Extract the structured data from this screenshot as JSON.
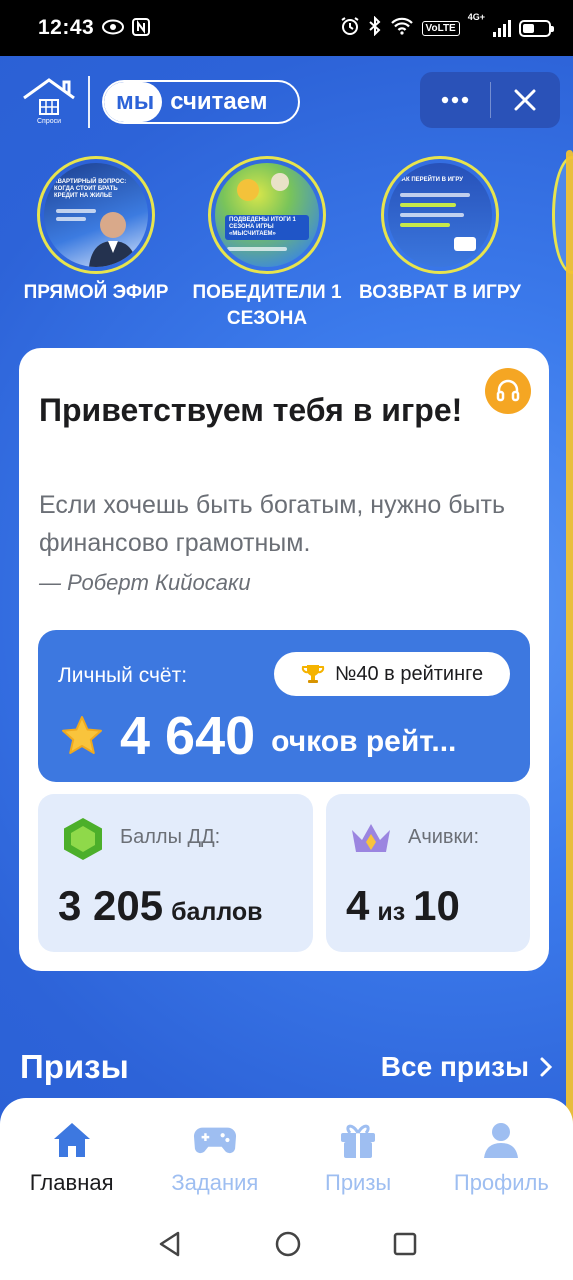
{
  "status_bar": {
    "time": "12:43",
    "network": "4G+",
    "volte": "VoLTE"
  },
  "header": {
    "logo_caption": "Спроси",
    "brand_part1": "мы",
    "brand_part2": "считаем",
    "more_icon": "more-dots-icon",
    "close_icon": "close-icon"
  },
  "stories": [
    {
      "label": "ПРЯМОЙ ЭФИР",
      "preview_text": "КВАРТИРНЫЙ ВОПРОС: КОГДА СТОИТ БРАТЬ КРЕДИТ НА ЖИЛЬЕ"
    },
    {
      "label": "ПОБЕДИТЕЛИ 1 СЕЗОНА",
      "preview_text": "ПОДВЕДЕНЫ ИТОГИ 1 СЕЗОНА ИГРЫ «МЫСЧИТАЕМ»"
    },
    {
      "label": "ВОЗВРАТ В ИГРУ",
      "preview_text": "КАК ПЕРЕЙТИ В ИГРУ"
    }
  ],
  "card": {
    "welcome": "Приветствуем тебя в игре!",
    "quote": "Если хочешь быть богатым, нужно быть финансово грамотным.",
    "author": "— Роберт Кийосаки",
    "score": {
      "label": "Личный счёт:",
      "rank": "№40 в рейтинге",
      "value": "4 640",
      "unit": "очков рейт..."
    },
    "dd": {
      "label": "Баллы ДД:",
      "value": "3 205",
      "unit": "баллов"
    },
    "achievements": {
      "label": "Ачивки:",
      "value": "4",
      "between": "из",
      "total": "10"
    }
  },
  "prizes": {
    "title": "Призы",
    "all_link": "Все призы"
  },
  "tabs": [
    {
      "label": "Главная",
      "icon": "home-icon",
      "active": true
    },
    {
      "label": "Задания",
      "icon": "gamepad-icon",
      "active": false
    },
    {
      "label": "Призы",
      "icon": "gift-icon",
      "active": false
    },
    {
      "label": "Профиль",
      "icon": "profile-icon",
      "active": false
    }
  ],
  "colors": {
    "accent": "#3d78e0",
    "background": "#2f6fe4",
    "tab_inactive": "#9ebef1",
    "story_ring": "#e7e44e",
    "support": "#f5a623"
  }
}
